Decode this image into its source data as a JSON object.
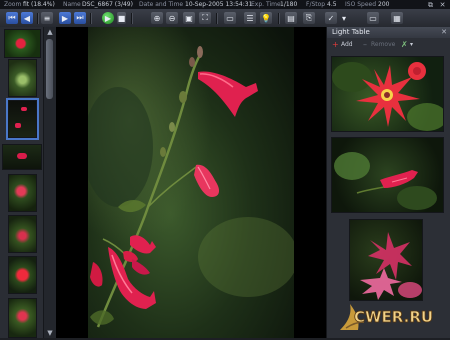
{
  "info_bar": {
    "zoom_label": "Zoom",
    "zoom_value": "fit (18.4%)",
    "name_label": "Name",
    "name_value": "DSC_6867 (3/49)",
    "date_label": "Date and Time",
    "date_value": "10-Sep-2005  13:54:31",
    "exp_label": "Exp. Time",
    "exp_value": "1/180",
    "fstop_label": "F/Stop",
    "fstop_value": "4.5",
    "iso_label": "ISO Speed",
    "iso_value": "200"
  },
  "toolbar": {
    "icons": [
      "first-icon",
      "prev-icon",
      "next-icon",
      "last-icon",
      "details-icon",
      "play-icon",
      "stop-icon",
      "zoom-in-icon",
      "zoom-out-icon",
      "image-icon",
      "fullscreen-icon",
      "slideshow-icon",
      "info-icon",
      "light-icon",
      "box-icon",
      "link-icon",
      "check-icon",
      "screen-icon",
      "grid-icon"
    ]
  },
  "light_table": {
    "title": "Light Table",
    "add_label": "Add",
    "remove_label": "Remove"
  },
  "watermark": {
    "text": "CWER.RU"
  },
  "colors": {
    "accent": "#4a78c9",
    "flower": "#e0214f",
    "background": "#1d1f24"
  }
}
